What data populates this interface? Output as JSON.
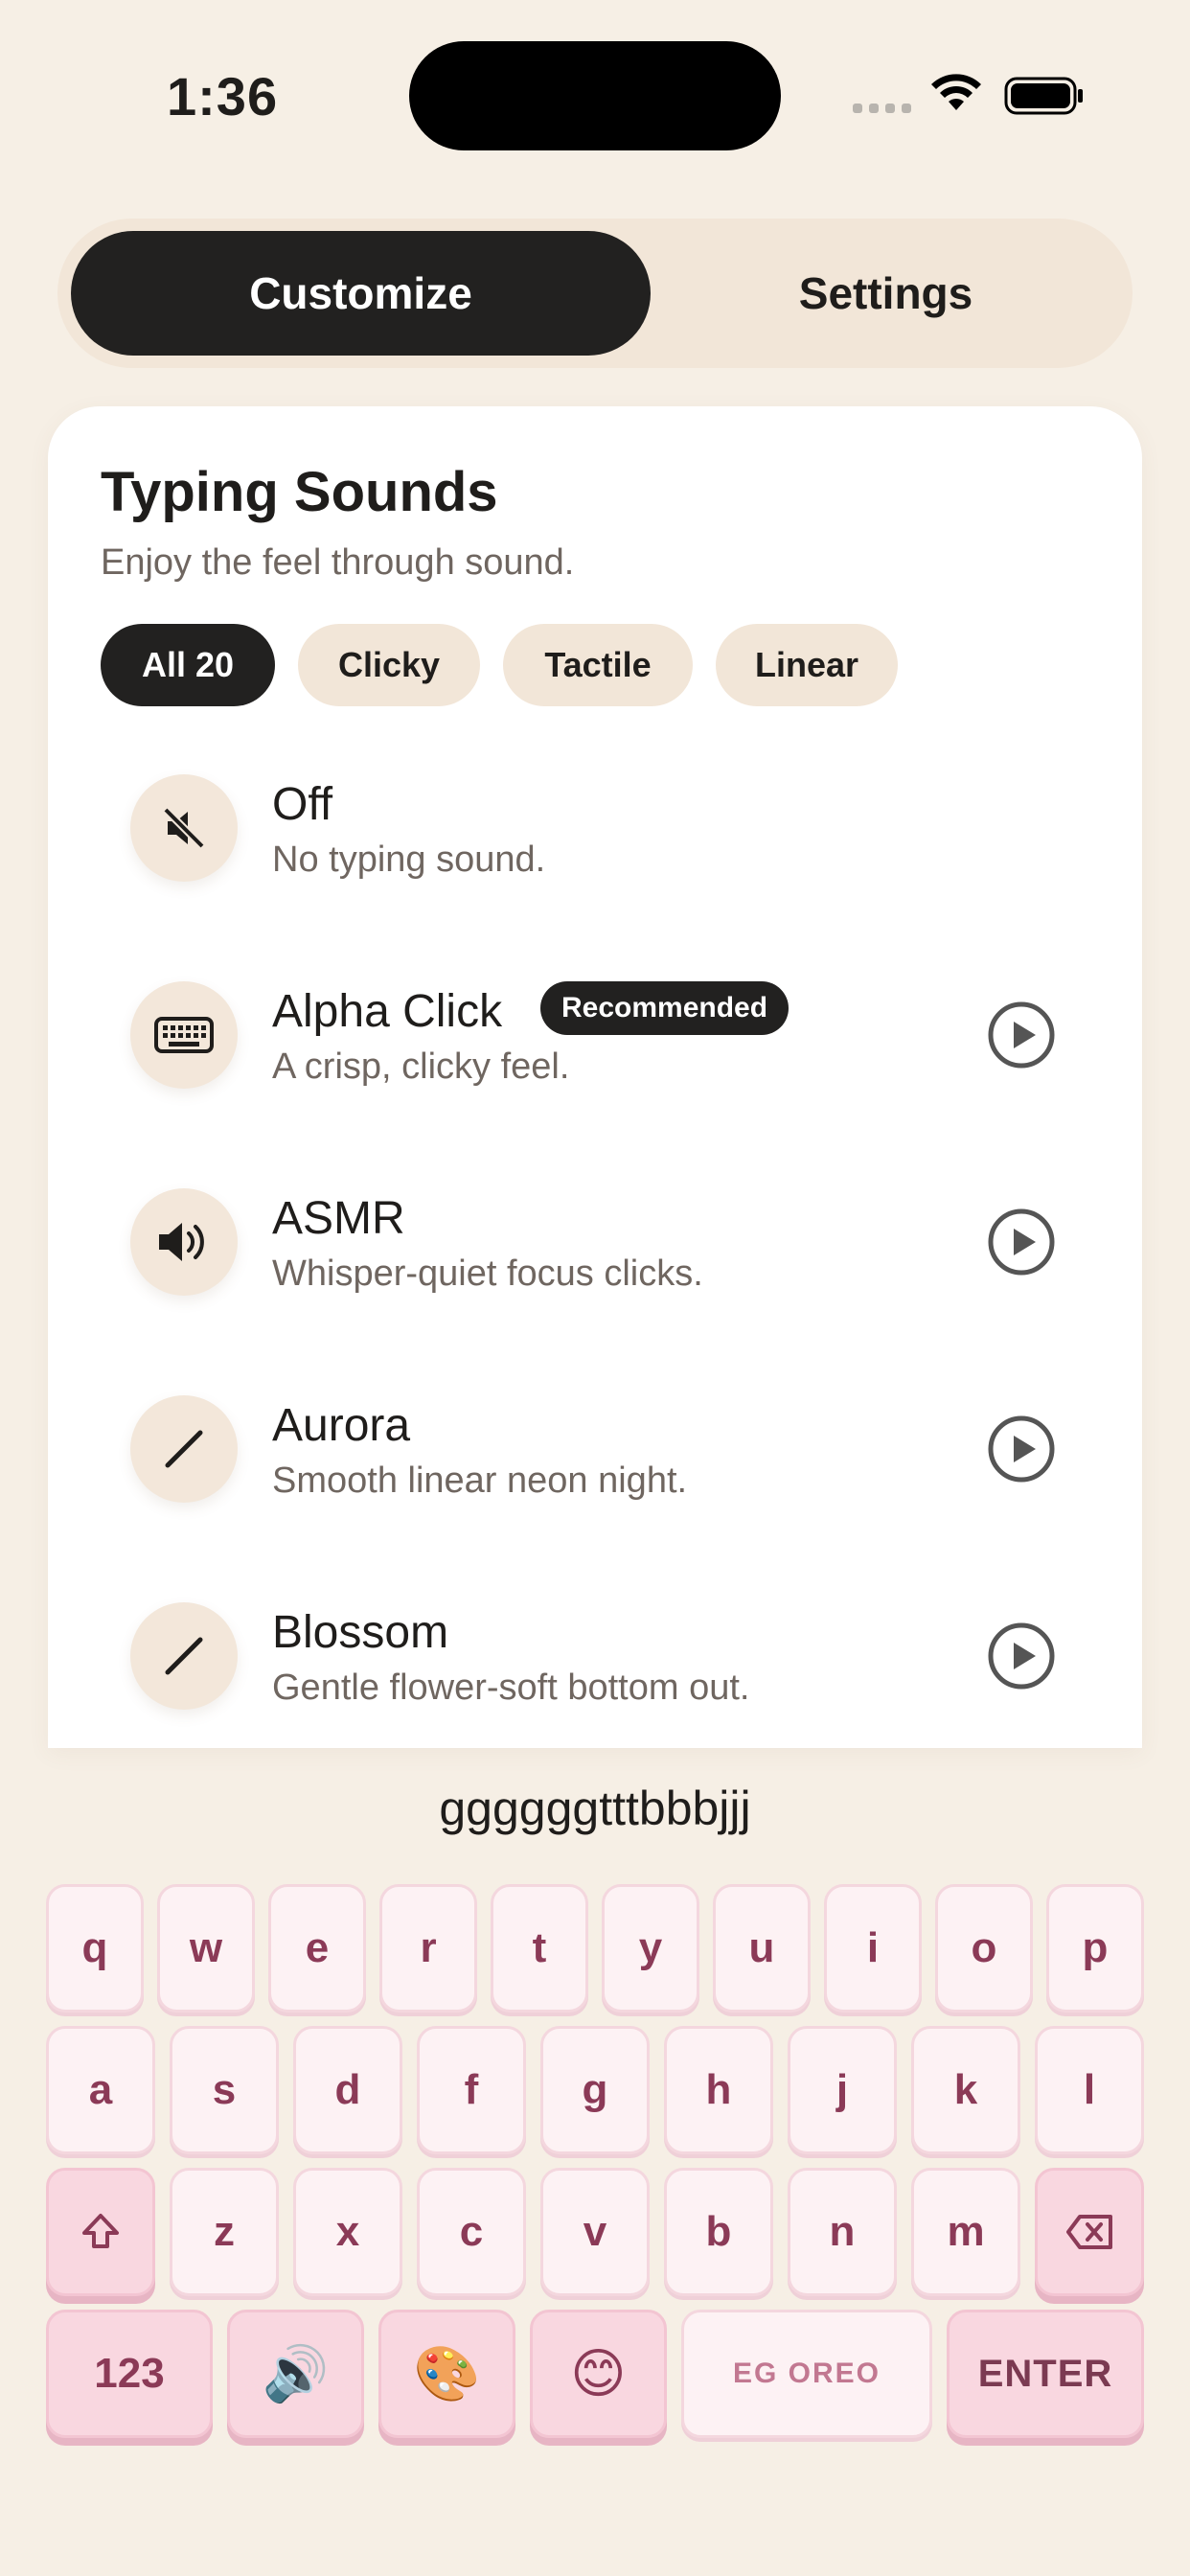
{
  "status_bar": {
    "time": "1:36"
  },
  "tabs": {
    "customize": "Customize",
    "settings": "Settings"
  },
  "card": {
    "title": "Typing Sounds",
    "subtitle": "Enjoy the feel through sound.",
    "filters": [
      "All 20",
      "Clicky",
      "Tactile",
      "Linear"
    ],
    "sounds": [
      {
        "name": "Off",
        "description": "No typing sound.",
        "icon": "muted-speaker-icon"
      },
      {
        "name": "Alpha Click",
        "description": "A crisp, clicky feel.",
        "badge": "Recommended",
        "icon": "keyboard-icon"
      },
      {
        "name": "ASMR",
        "description": "Whisper-quiet focus clicks.",
        "icon": "speaker-icon"
      },
      {
        "name": "Aurora",
        "description": "Smooth linear neon night.",
        "icon": "slash-icon"
      },
      {
        "name": "Blossom",
        "description": "Gentle flower-soft bottom out.",
        "icon": "slash-icon"
      }
    ]
  },
  "keyboard": {
    "typed_text": "ggggggtttbbbjjj",
    "row1": [
      "q",
      "w",
      "e",
      "r",
      "t",
      "y",
      "u",
      "i",
      "o",
      "p"
    ],
    "row2": [
      "a",
      "s",
      "d",
      "f",
      "g",
      "h",
      "j",
      "k",
      "l"
    ],
    "row3": [
      "z",
      "x",
      "c",
      "v",
      "b",
      "n",
      "m"
    ],
    "numbers_label": "123",
    "sound_emoji": "🔊",
    "palette_emoji": "🎨",
    "smile_emoji": "😊",
    "space_label": "EG OREO",
    "enter_label": "ENTER"
  },
  "colors": {
    "accent_dark": "#222120",
    "background": "#f6efe5",
    "key_text": "#8b3a57",
    "key_pink": "#f9d7e0"
  }
}
